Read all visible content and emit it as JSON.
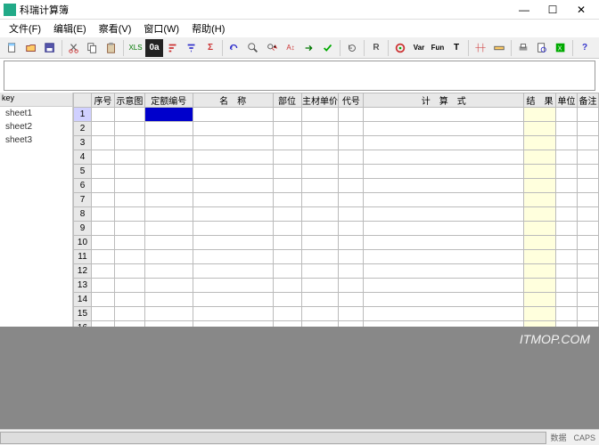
{
  "window": {
    "title": "科瑞计算簿",
    "min": "—",
    "max": "☐",
    "close": "✕"
  },
  "menu": {
    "file": "文件(F)",
    "edit": "编辑(E)",
    "view": "察看(V)",
    "window": "窗口(W)",
    "help": "帮助(H)"
  },
  "sheets": [
    "sheet1",
    "sheet2",
    "sheet3"
  ],
  "sidetab": "key",
  "columns": {
    "seq": "序号",
    "diagram": "示意图",
    "quota": "定额编号",
    "name": "名　称",
    "part": "部位",
    "matprice": "主材单价",
    "code": "代号",
    "calc": "计　算　式",
    "result": "结　果",
    "unit": "单位",
    "note": "备注"
  },
  "col_widths": {
    "rownum": 20,
    "seq": 26,
    "diagram": 34,
    "quota": 54,
    "name": 90,
    "part": 32,
    "matprice": 42,
    "code": 28,
    "calc": 180,
    "result": 36,
    "unit": 24,
    "note": 24
  },
  "row_count": 19,
  "selected_row": 1,
  "selected_col": "quota",
  "watermark": "ITMOP.COM",
  "status": {
    "right1": "数据",
    "right2": "CAPS"
  }
}
